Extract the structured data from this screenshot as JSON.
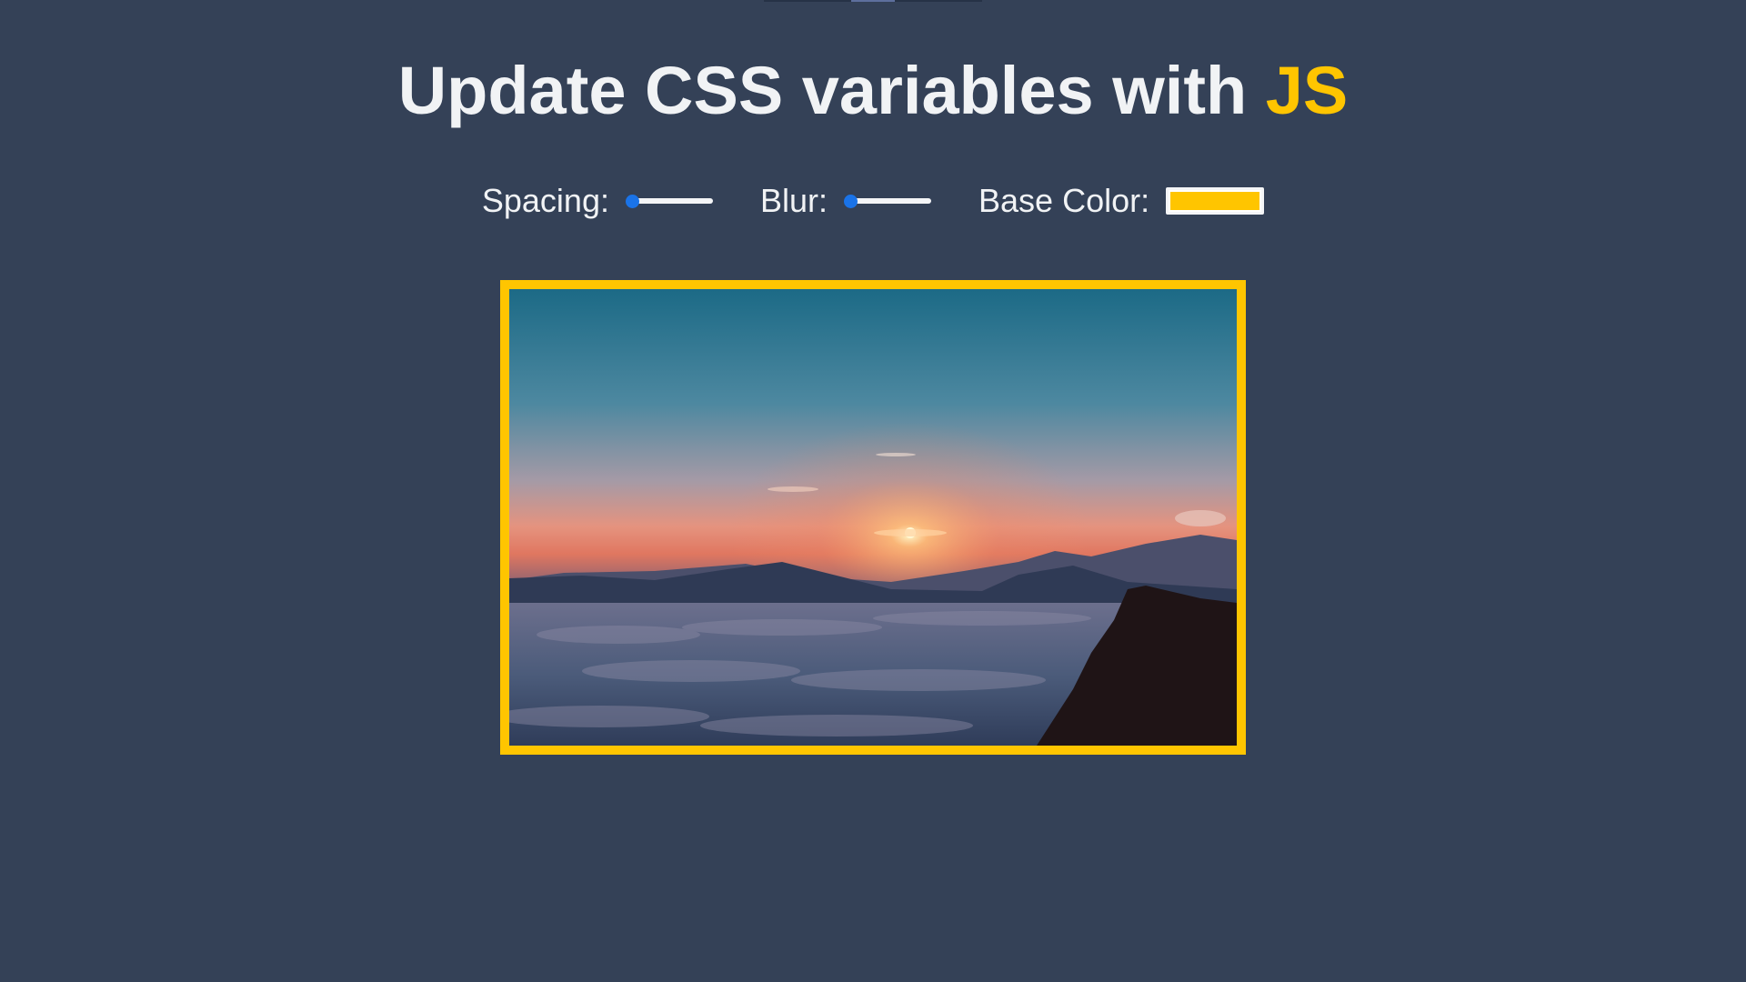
{
  "page": {
    "title_main": "Update CSS variables with ",
    "title_highlight": "JS"
  },
  "controls": {
    "spacing": {
      "label": "Spacing:",
      "value": 0.0
    },
    "blur": {
      "label": "Blur:",
      "value": 0.0
    },
    "base_color": {
      "label": "Base Color:",
      "value": "#ffc500"
    }
  },
  "colors": {
    "background": "#344157",
    "accent": "#ffc500",
    "slider_thumb": "#1a73e8"
  },
  "image": {
    "subject": "sunset-over-clouds-mountains"
  }
}
